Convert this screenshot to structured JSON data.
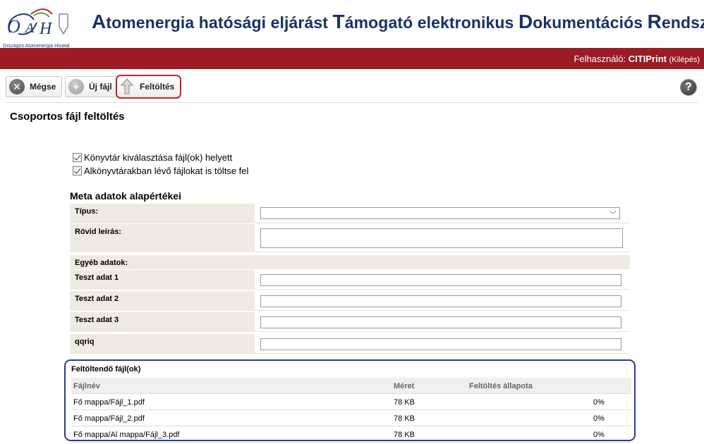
{
  "brand": {
    "logo_letters": "OAH",
    "logo_sub": "Országos Atomenergia Hivatal",
    "title_parts": [
      {
        "big": "A",
        "rest": "tomenergia hatósági eljárást "
      },
      {
        "big": "T",
        "rest": "ámogató elektronikus "
      },
      {
        "big": "D",
        "rest": "okumentációs "
      },
      {
        "big": "R",
        "rest": "endszer"
      }
    ],
    "accent": "#9b1c24",
    "title_color": "#1a3263"
  },
  "userbar": {
    "label": "Felhasználó:",
    "username": "CITIPrint",
    "logout": "(Kilépés)"
  },
  "toolbar": {
    "cancel_label": "Mégse",
    "new_file_label": "Új fájl",
    "upload_label": "Feltöltés",
    "help_label": "?"
  },
  "page": {
    "title": "Csoportos fájl feltöltés"
  },
  "options": {
    "dir_select": {
      "label": "Könyvtár kiválasztása fájl(ok) helyett",
      "checked": true
    },
    "subdirs": {
      "label": "Alkönyvtárakban lévő fájlokat is töltse fel",
      "checked": true
    }
  },
  "meta": {
    "title": "Meta adatok alapértékei",
    "type_label": "Típus:",
    "type_value": "",
    "desc_label": "Rövid leírás:",
    "desc_value": "",
    "other_label": "Egyéb adatok:",
    "fields": [
      {
        "label": "Teszt adat 1",
        "value": ""
      },
      {
        "label": "Teszt adat 2",
        "value": ""
      },
      {
        "label": "Teszt adat 3",
        "value": ""
      },
      {
        "label": "qqriq",
        "value": ""
      }
    ]
  },
  "files": {
    "title": "Feltöltendő fájl(ok)",
    "columns": {
      "name": "Fájlnév",
      "size": "Méret",
      "status": "Feltöltés állapota"
    },
    "rows": [
      {
        "name": "Fő mappa/Fájl_1.pdf",
        "size": "78 KB",
        "status": "0%"
      },
      {
        "name": "Fő mappa/Fájl_2.pdf",
        "size": "78 KB",
        "status": "0%"
      },
      {
        "name": "Fő mappa/Al mappa/Fájl_3.pdf",
        "size": "78 KB",
        "status": "0%"
      }
    ]
  }
}
